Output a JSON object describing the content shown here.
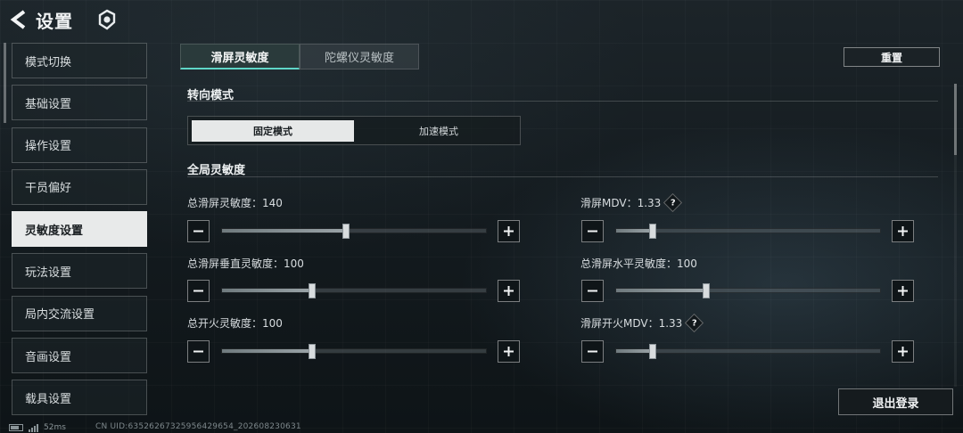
{
  "header": {
    "title": "设置"
  },
  "menu": {
    "items": [
      {
        "label": "模式切换",
        "active": false
      },
      {
        "label": "基础设置",
        "active": false
      },
      {
        "label": "操作设置",
        "active": false
      },
      {
        "label": "干员偏好",
        "active": false
      },
      {
        "label": "灵敏度设置",
        "active": true
      },
      {
        "label": "玩法设置",
        "active": false
      },
      {
        "label": "局内交流设置",
        "active": false
      },
      {
        "label": "音画设置",
        "active": false
      },
      {
        "label": "载具设置",
        "active": false
      }
    ]
  },
  "tabs": [
    {
      "label": "滑屏灵敏度",
      "active": true
    },
    {
      "label": "陀螺仪灵敏度",
      "active": false
    }
  ],
  "reset_label": "重置",
  "turn_mode": {
    "title": "转向模式",
    "options": [
      {
        "label": "固定模式",
        "active": true
      },
      {
        "label": "加速模式",
        "active": false
      }
    ]
  },
  "global": {
    "title": "全局灵敏度",
    "sliders": [
      {
        "label": "总滑屏灵敏度：140",
        "fraction": 0.47,
        "help": false
      },
      {
        "label": "滑屏MDV：1.33",
        "fraction": 0.14,
        "help": true
      },
      {
        "label": "总滑屏垂直灵敏度：100",
        "fraction": 0.34,
        "help": false
      },
      {
        "label": "总滑屏水平灵敏度：100",
        "fraction": 0.34,
        "help": false
      },
      {
        "label": "总开火灵敏度：100",
        "fraction": 0.34,
        "help": false
      },
      {
        "label": "滑屏开火MDV：1.33",
        "fraction": 0.14,
        "help": true
      }
    ]
  },
  "help_symbol": "?",
  "logout_label": "退出登录",
  "status": {
    "ping": "52ms",
    "uid": "CN UID:63526267325956429654_202608230631"
  }
}
